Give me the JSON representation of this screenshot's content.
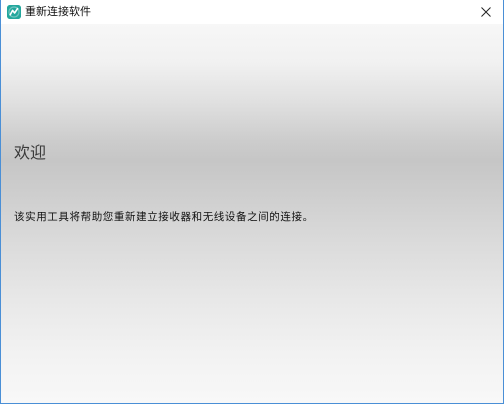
{
  "window": {
    "title": "重新连接软件",
    "app_icon": "logitech-unifying-icon",
    "close_icon": "close-icon"
  },
  "main": {
    "heading": "欢迎",
    "description": "该实用工具将帮助您重新建立接收器和无线设备之间的连接。"
  },
  "colors": {
    "accent": "#4a8fd6",
    "app_icon_bg": "#23a79d",
    "gradient_light": "#f7f7f7",
    "gradient_dark": "#c6c6c6"
  }
}
